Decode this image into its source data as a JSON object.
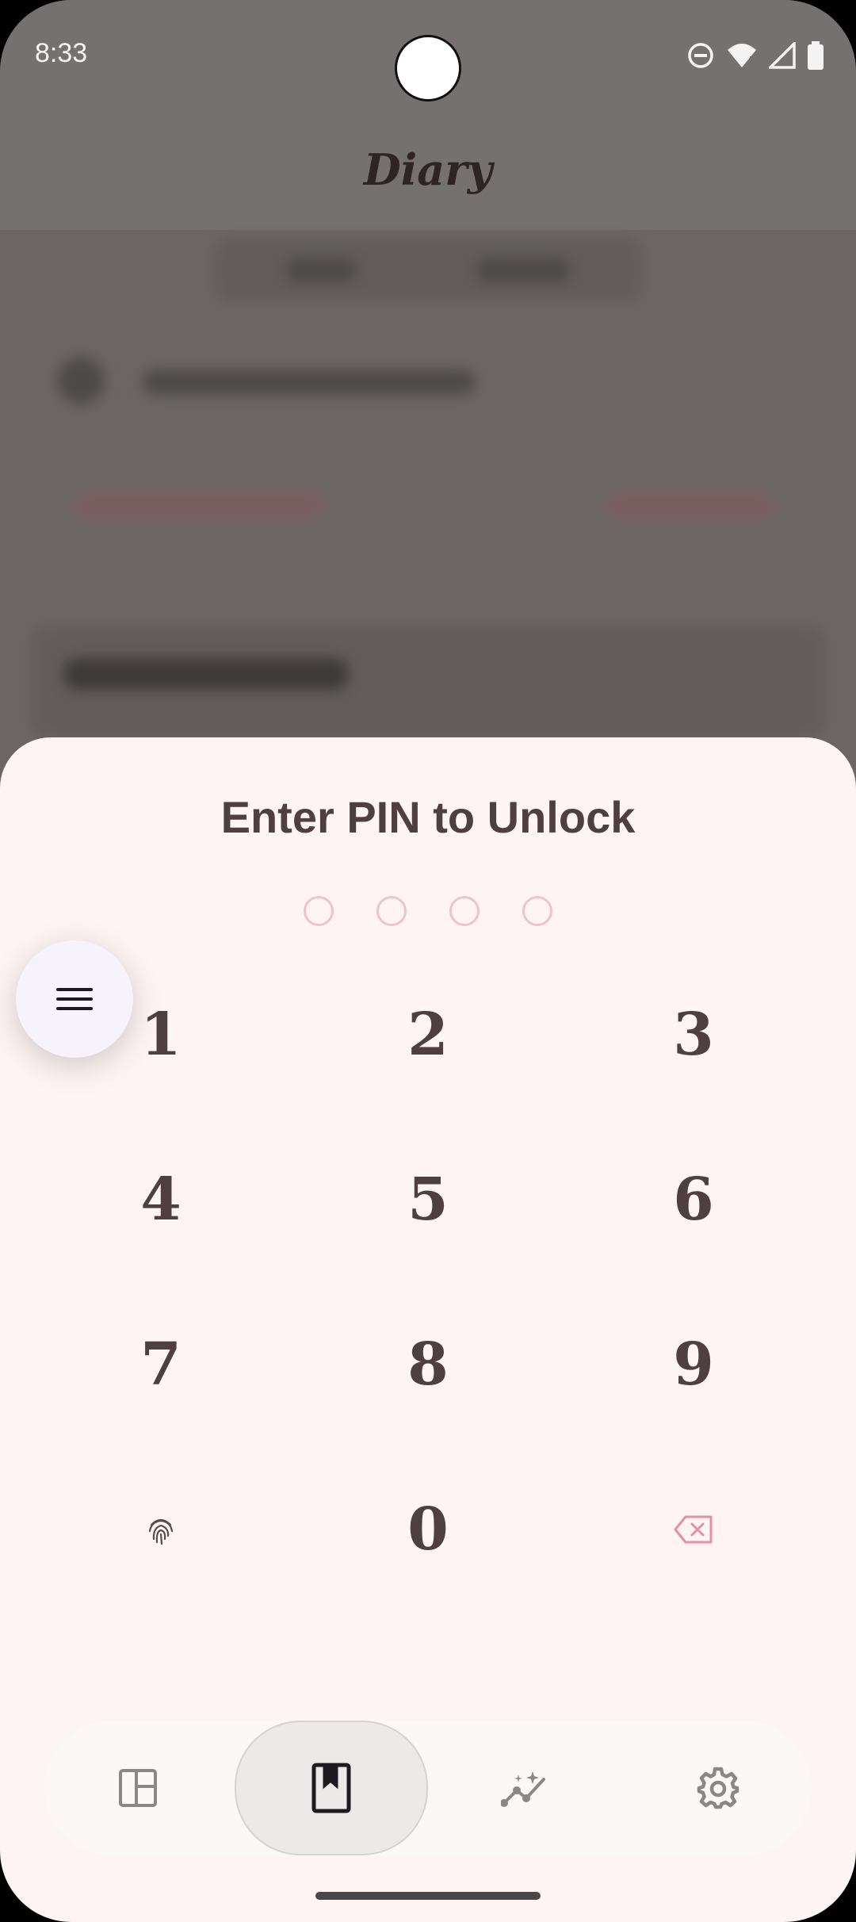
{
  "status": {
    "time": "8:33"
  },
  "app": {
    "title": "Diary"
  },
  "pin_sheet": {
    "title": "Enter PIN to Unlock",
    "pin_length": 4,
    "keys": [
      "1",
      "2",
      "3",
      "4",
      "5",
      "6",
      "7",
      "8",
      "9",
      "0"
    ]
  },
  "icons": {
    "menu": "menu-icon",
    "fingerprint": "fingerprint-icon",
    "backspace": "backspace-icon",
    "dashboard": "dashboard-icon",
    "journal": "bookmark-book-icon",
    "insights": "insights-chart-icon",
    "settings": "gear-icon"
  },
  "colors": {
    "sheet_bg": "#fdf4f3",
    "text": "#4f3f41",
    "accent_pink": "#e78fa8",
    "dim_overlay": "#6b6665"
  }
}
